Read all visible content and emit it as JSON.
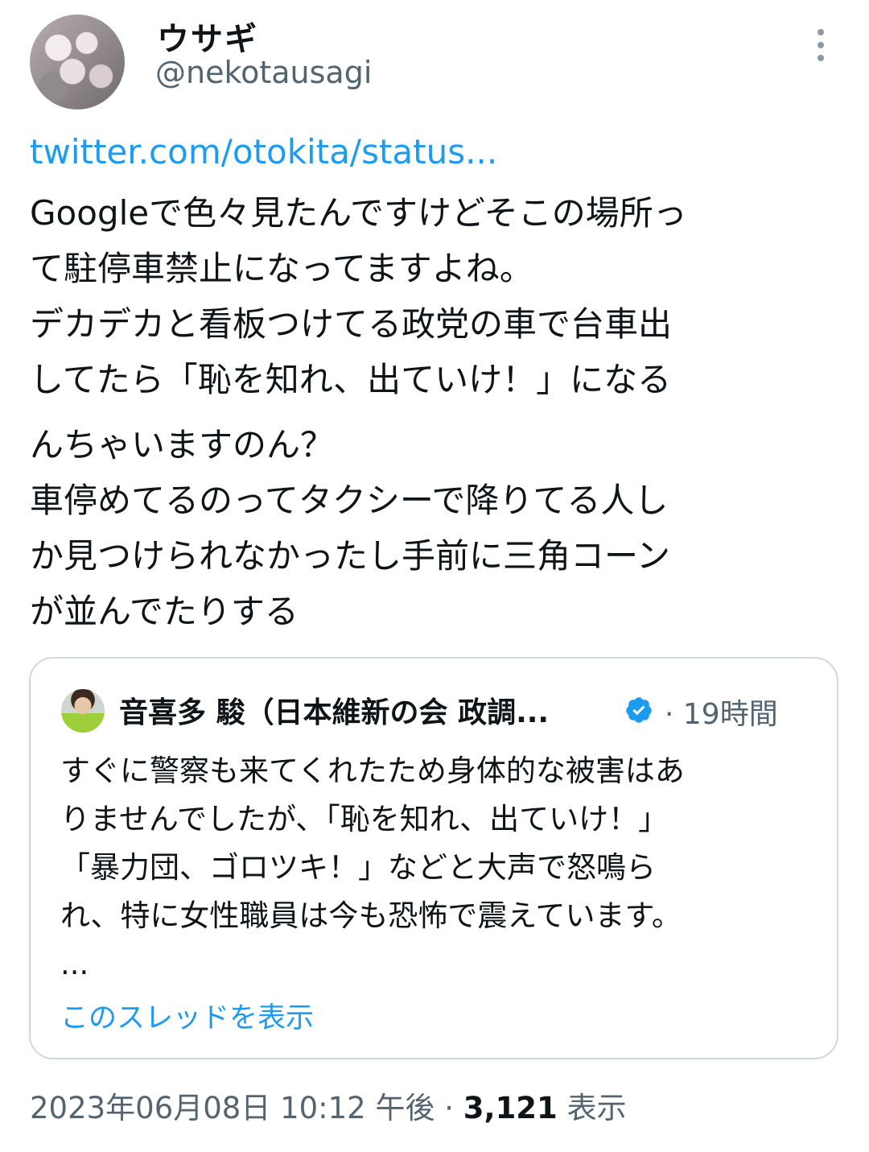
{
  "author": {
    "name": "ウサギ",
    "handle": "@nekotausagi"
  },
  "tweet": {
    "link": "twitter.com/otokita/status...",
    "lines": [
      "Googleで色々見たんですけどそこの場所っ",
      "て駐停車禁止になってますよね。",
      "デカデカと看板つけてる政党の車で台車出",
      "してたら「恥を知れ、出ていけ！」になる",
      "んちゃいますのん？",
      "車停めてるのってタクシーで降りてる人し",
      "か見つけられなかったし手前に三角コーン",
      "が並んでたりする"
    ]
  },
  "quoted": {
    "name": "音喜多 駿（日本維新の会 政調...",
    "time": "· 19時間",
    "lines": [
      "すぐに警察も来てくれたため身体的な被害はあ",
      "りませんでしたが、「恥を知れ、出ていけ！」",
      "「暴力団、ゴロツキ！」などと大声で怒鳴ら",
      "れ、特に女性職員は今も恐怖で震えています。",
      "..."
    ],
    "thread_link": "このスレッドを表示"
  },
  "footer": {
    "datetime": "2023年06月08日 10:12 午後 · ",
    "views_count": "3,121",
    "views_label": " 表示"
  },
  "colors": {
    "link": "#1d9bf0",
    "secondary": "#536471",
    "border": "#cfd9de"
  }
}
